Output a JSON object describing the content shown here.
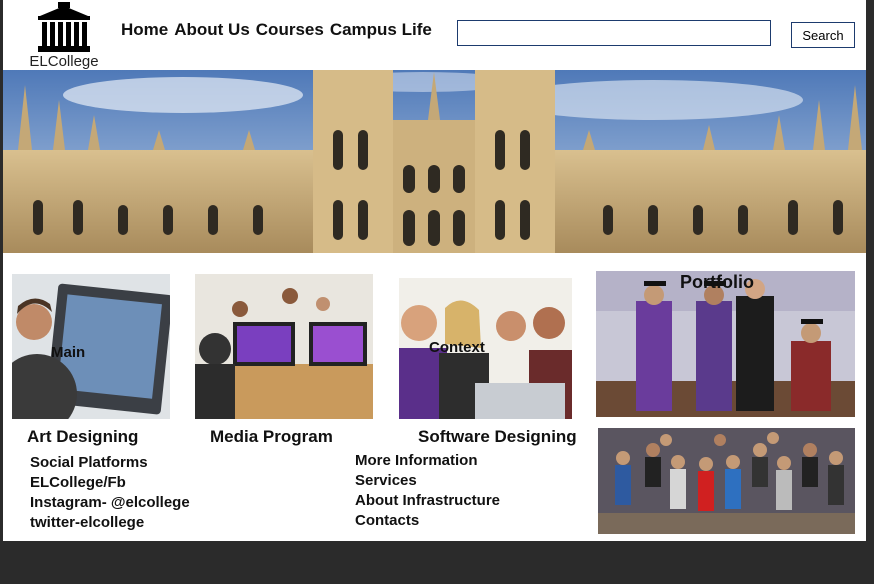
{
  "brand": {
    "name": "ELCollege"
  },
  "nav": {
    "items": [
      {
        "label": "Home"
      },
      {
        "label": "About Us"
      },
      {
        "label": "Courses"
      },
      {
        "label": "Campus Life"
      }
    ]
  },
  "search": {
    "value": "",
    "placeholder": "",
    "button_label": "Search"
  },
  "cards": {
    "main_label": "Main",
    "context_label": "Context",
    "portfolio_label": "Portfolio",
    "captions": {
      "art": "Art Designing",
      "media": "Media Program",
      "software": "Software Designing"
    }
  },
  "social": {
    "items": [
      {
        "label": "Social Platforms"
      },
      {
        "label": "ELCollege/Fb"
      },
      {
        "label": "Instagram- @elcollege"
      },
      {
        "label": "twitter-elcollege"
      }
    ]
  },
  "info": {
    "items": [
      {
        "label": "More Information"
      },
      {
        "label": "Services"
      },
      {
        "label": "About Infrastructure"
      },
      {
        "label": "Contacts"
      }
    ]
  },
  "colors": {
    "frame": "#2b2b2b",
    "accent_border": "#1d3b6e"
  }
}
